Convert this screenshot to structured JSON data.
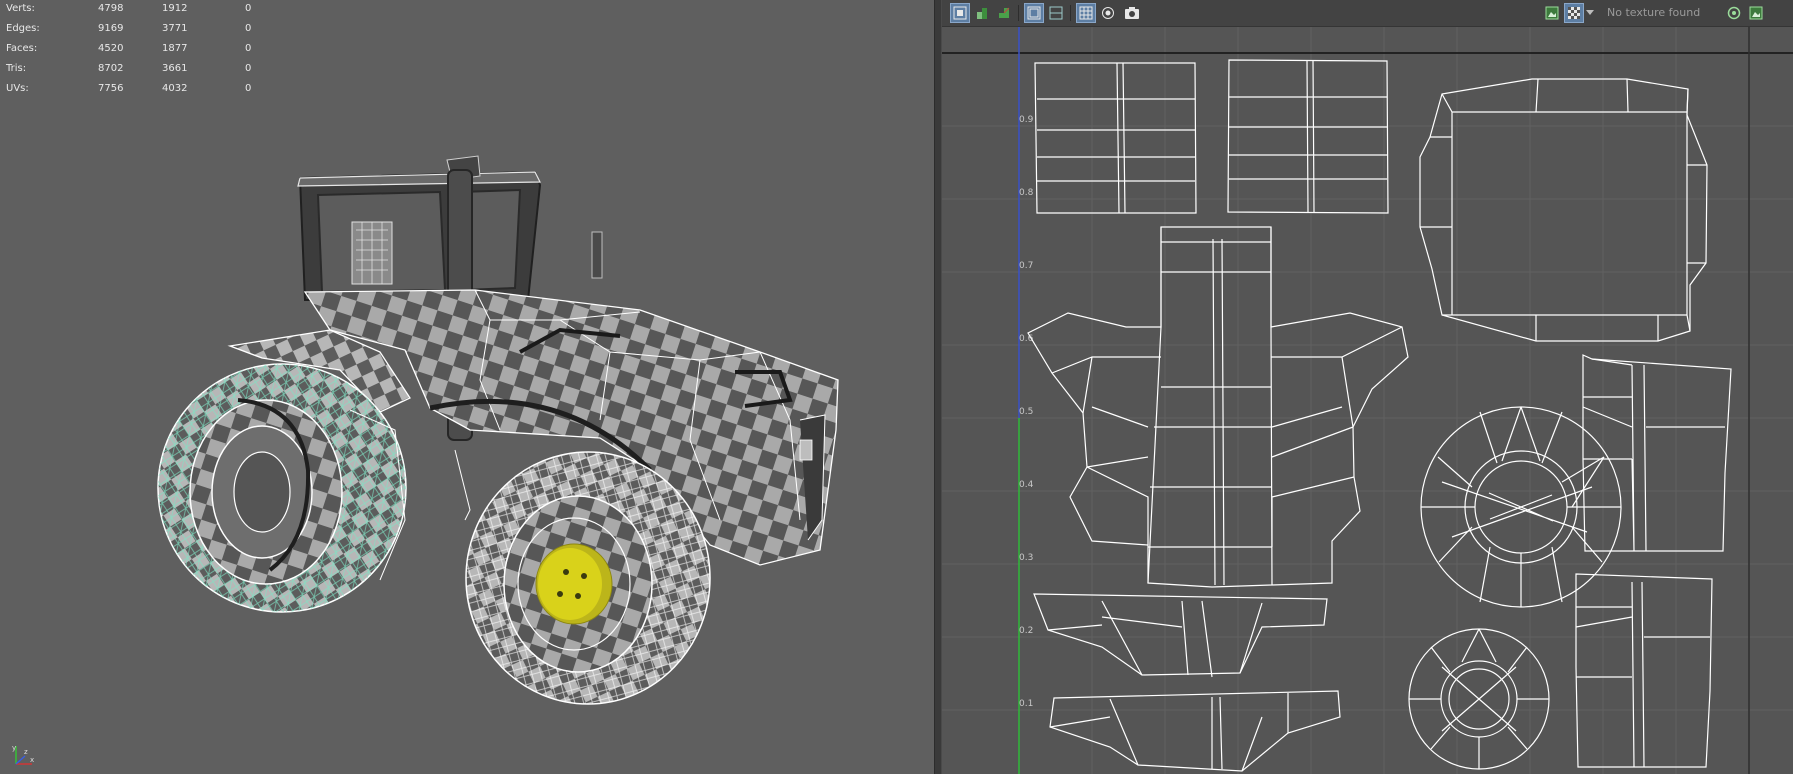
{
  "stats": {
    "rows": [
      {
        "label": "Verts:",
        "v1": "4798",
        "v2": "1912",
        "v3": "0"
      },
      {
        "label": "Edges:",
        "v1": "9169",
        "v2": "3771",
        "v3": "0"
      },
      {
        "label": "Faces:",
        "v1": "4520",
        "v2": "1877",
        "v3": "0"
      },
      {
        "label": "Tris:",
        "v1": "8702",
        "v2": "3661",
        "v3": "0"
      },
      {
        "label": "UVs:",
        "v1": "7756",
        "v2": "4032",
        "v3": "0"
      }
    ]
  },
  "uv_editor": {
    "texture_status": "No texture found",
    "grid_labels": [
      "0.9",
      "0.8",
      "0.7",
      "0.6",
      "0.5",
      "0.4",
      "0.3",
      "0.2",
      "0.1"
    ],
    "left_tools": [
      "uv-shell-select-icon",
      "uv-shaded-icon",
      "uv-distortion-icon",
      "display-image-icon",
      "dim-image-icon",
      "grid-toggle-icon",
      "pixel-snap-icon",
      "snapshot-icon"
    ],
    "right_tools": [
      "image-display-icon",
      "checker-map-icon",
      "dropdown-arrow-icon",
      "uv-settings-icon",
      "image-range-icon"
    ]
  },
  "colors": {
    "viewport_bg": "#5f5f5f",
    "uv_bg": "#555555",
    "wireframe": "#ffffff",
    "selected_wire": "#7fe3c4",
    "hub_yellow": "#d9d21a",
    "axis_v": "#3a52c8",
    "axis_u": "#2fb93a"
  }
}
